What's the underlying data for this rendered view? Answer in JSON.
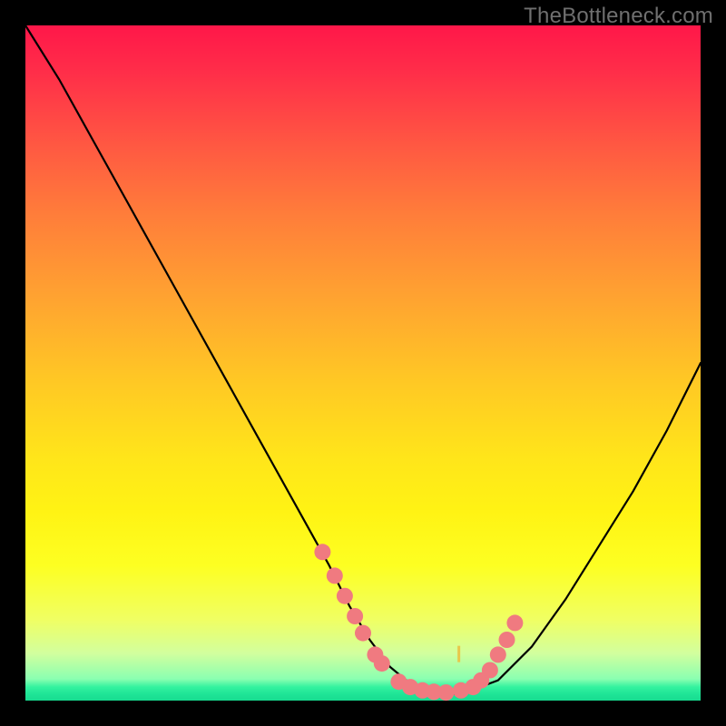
{
  "watermark": "TheBottleneck.com",
  "chart_data": {
    "type": "line",
    "title": "",
    "xlabel": "",
    "ylabel": "",
    "xlim": [
      0,
      100
    ],
    "ylim": [
      0,
      100
    ],
    "series": [
      {
        "name": "bottleneck-curve",
        "x": [
          0,
          5,
          10,
          15,
          20,
          25,
          30,
          35,
          40,
          45,
          48,
          51,
          54,
          57,
          60,
          62,
          64,
          66,
          70,
          75,
          80,
          85,
          90,
          95,
          100
        ],
        "y": [
          100,
          92,
          83,
          74,
          65,
          56,
          47,
          38,
          29,
          20,
          14,
          9,
          5,
          2.5,
          1.3,
          1.0,
          1.0,
          1.5,
          3,
          8,
          15,
          23,
          31,
          40,
          50
        ]
      }
    ],
    "markers": {
      "name": "highlight-dots",
      "color": "#f07a80",
      "radius": 9,
      "points_xy": [
        [
          44.0,
          22.0
        ],
        [
          45.8,
          18.5
        ],
        [
          47.3,
          15.5
        ],
        [
          48.8,
          12.5
        ],
        [
          50.0,
          10.0
        ],
        [
          51.8,
          6.8
        ],
        [
          52.8,
          5.5
        ],
        [
          55.3,
          2.8
        ],
        [
          57.0,
          2.0
        ],
        [
          58.8,
          1.5
        ],
        [
          60.5,
          1.3
        ],
        [
          62.3,
          1.2
        ],
        [
          64.5,
          1.5
        ],
        [
          66.3,
          2.0
        ],
        [
          67.5,
          3.0
        ],
        [
          68.8,
          4.5
        ],
        [
          70.0,
          6.8
        ],
        [
          71.3,
          9.0
        ],
        [
          72.5,
          11.5
        ]
      ]
    },
    "annotations": []
  }
}
